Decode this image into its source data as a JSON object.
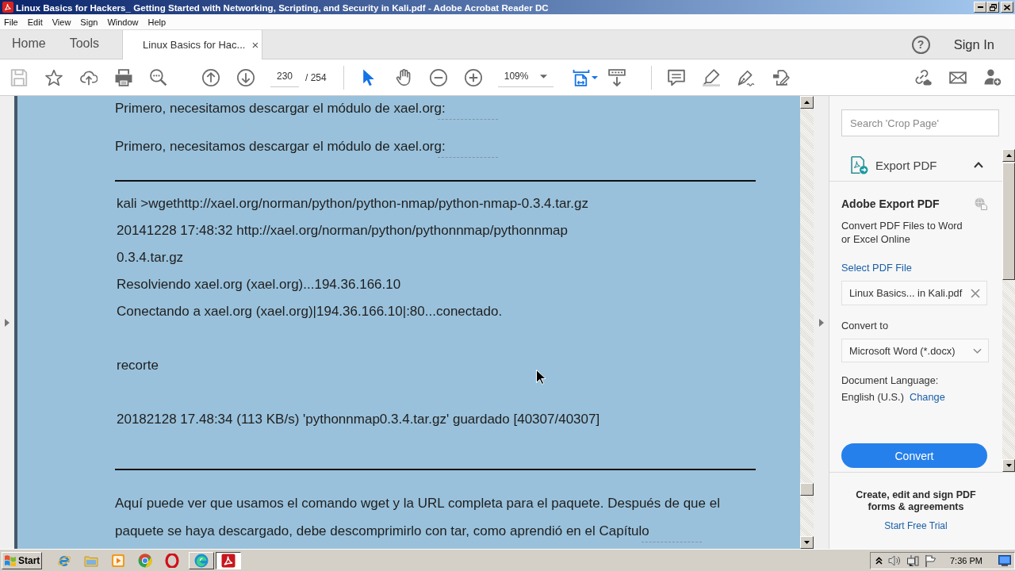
{
  "window": {
    "title": "Linux Basics for Hackers_ Getting Started with Networking, Scripting, and Security in Kali.pdf - Adobe Acrobat Reader DC"
  },
  "menu_bar": [
    "File",
    "Edit",
    "View",
    "Sign",
    "Window",
    "Help"
  ],
  "tabs": [
    {
      "label": "Home",
      "kind": "nav",
      "selected": false
    },
    {
      "label": "Tools",
      "kind": "nav",
      "selected": false
    },
    {
      "label": "Linux Basics for Hac...",
      "kind": "document",
      "selected": true,
      "close": "×"
    }
  ],
  "account": {
    "help": "?",
    "sign_in": "Sign In"
  },
  "toolbar": {
    "save_disabled": true,
    "page_current": "230",
    "page_count": "/ 254",
    "pointer_tools": [
      {
        "kind": "select",
        "selected": true
      },
      {
        "kind": "hand",
        "selected": false
      }
    ],
    "zoom": "109%"
  },
  "document": {
    "blocks": [
      {
        "kind": "paragraph",
        "text": "Primero, necesitamos descargar el módulo de xael.org:",
        "link_underline": true
      },
      {
        "kind": "paragraph",
        "text": "Primero, necesitamos descargar el módulo de xael.org:",
        "link_underline": true
      },
      {
        "kind": "rule"
      },
      {
        "kind": "code",
        "text": "kali >wgethttp://xael.org/norman/python/python-nmap/python-nmap-0.3.4.tar.gz"
      },
      {
        "kind": "code",
        "text": "20141228 17:48:32 http://xael.org/norman/python/pythonnmap/pythonnmap"
      },
      {
        "kind": "code",
        "text": "0.3.4.tar.gz"
      },
      {
        "kind": "code",
        "text": "Resolviendo xael.org (xael.org)...194.36.166.10"
      },
      {
        "kind": "code",
        "text": "Conectando a xael.org (xael.org)|194.36.166.10|:80...conectado."
      },
      {
        "kind": "snip",
        "text": "recorte"
      },
      {
        "kind": "code",
        "text": "20182128 17.48:34 (113 KB/s) 'pythonnmap0.3.4.tar.gz' guardado [40307/40307]"
      },
      {
        "kind": "rule"
      },
      {
        "kind": "paragraph",
        "text": "Aquí puede ver que usamos el comando wget y la URL completa para el paquete. Después de que el paquete se haya descargado, debe descomprimirlo con tar, como aprendió en el Capítulo",
        "link_underline": true
      }
    ]
  },
  "tools_panel": {
    "search": {
      "placeholder": "Search 'Crop Page'"
    },
    "section": {
      "title": "Export PDF",
      "expanded": true
    },
    "heading": "Adobe Export PDF",
    "description": "Convert PDF Files to Word or Excel Online",
    "select_link": "Select PDF File",
    "file_field": {
      "value": "Linux Basics... in Kali.pdf"
    },
    "convert_label": "Convert to",
    "format_dropdown": {
      "value": "Microsoft Word (*.docx)"
    },
    "language_label": "Document Language:",
    "language": "English (U.S.)",
    "change_link": "Change",
    "convert_button": "Convert",
    "promo": {
      "text": "Create, edit and sign PDF forms & agreements",
      "link": "Start Free Trial"
    }
  },
  "taskbar": {
    "start": "Start",
    "quick_launch": [
      {
        "kind": "ie"
      },
      {
        "kind": "folder"
      },
      {
        "kind": "media"
      },
      {
        "kind": "chrome"
      },
      {
        "kind": "opera"
      }
    ],
    "tasks": [
      {
        "kind": "edge",
        "selected": false
      },
      {
        "kind": "acrobat",
        "selected": true
      }
    ],
    "clock": "7:36 PM"
  }
}
